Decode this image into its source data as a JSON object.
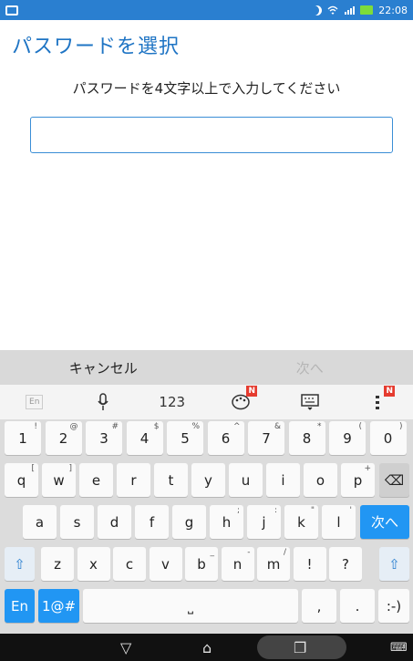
{
  "status_bar": {
    "time": "22:08",
    "icons": [
      "notification-icon",
      "moon-icon",
      "wifi-icon",
      "signal-icon",
      "battery-icon"
    ],
    "accent": "#2a7fd0"
  },
  "screen": {
    "title": "パスワードを選択",
    "instruction": "パスワードを4文字以上で入力してください",
    "password_value": ""
  },
  "actions": {
    "cancel_label": "キャンセル",
    "next_label": "次へ"
  },
  "kb_toolbar": {
    "lang_mini": "En",
    "num_label": "123",
    "badge1": "N",
    "badge2": "N"
  },
  "keyboard": {
    "row1": [
      [
        "1",
        "!"
      ],
      [
        "2",
        "@"
      ],
      [
        "3",
        "#"
      ],
      [
        "4",
        "$"
      ],
      [
        "5",
        "%"
      ],
      [
        "6",
        "^"
      ],
      [
        "7",
        "&"
      ],
      [
        "8",
        "*"
      ],
      [
        "9",
        "("
      ],
      [
        "0",
        ")"
      ]
    ],
    "row2": [
      [
        "q",
        "["
      ],
      [
        "w",
        "]"
      ],
      [
        "e",
        ""
      ],
      [
        "r",
        ""
      ],
      [
        "t",
        ""
      ],
      [
        "y",
        ""
      ],
      [
        "u",
        ""
      ],
      [
        "i",
        ""
      ],
      [
        "o",
        ""
      ],
      [
        "p",
        "+"
      ]
    ],
    "row3": [
      [
        "a",
        ""
      ],
      [
        "s",
        ""
      ],
      [
        "d",
        ""
      ],
      [
        "f",
        ""
      ],
      [
        "g",
        ""
      ],
      [
        "h",
        ";"
      ],
      [
        "j",
        ":"
      ],
      [
        "k",
        "\""
      ],
      [
        "l",
        "'"
      ]
    ],
    "row4": [
      [
        "z",
        ""
      ],
      [
        "x",
        ""
      ],
      [
        "c",
        ""
      ],
      [
        "v",
        ""
      ],
      [
        "b",
        "_"
      ],
      [
        "n",
        "-"
      ],
      [
        "m",
        "/"
      ],
      [
        "!",
        ""
      ],
      [
        "?",
        ""
      ]
    ],
    "next_key": "次へ",
    "en_key": "En",
    "sym_key": "1@#",
    "comma_key": ",",
    "period_key": ".",
    "smiley_key": ":-)",
    "space_symbol": "⎵",
    "shift_symbol": "⇧",
    "backspace_symbol": "⌫"
  },
  "nav": {
    "back": "▽",
    "home": "⌂",
    "recent": "❐",
    "keyboard": "⌨"
  }
}
